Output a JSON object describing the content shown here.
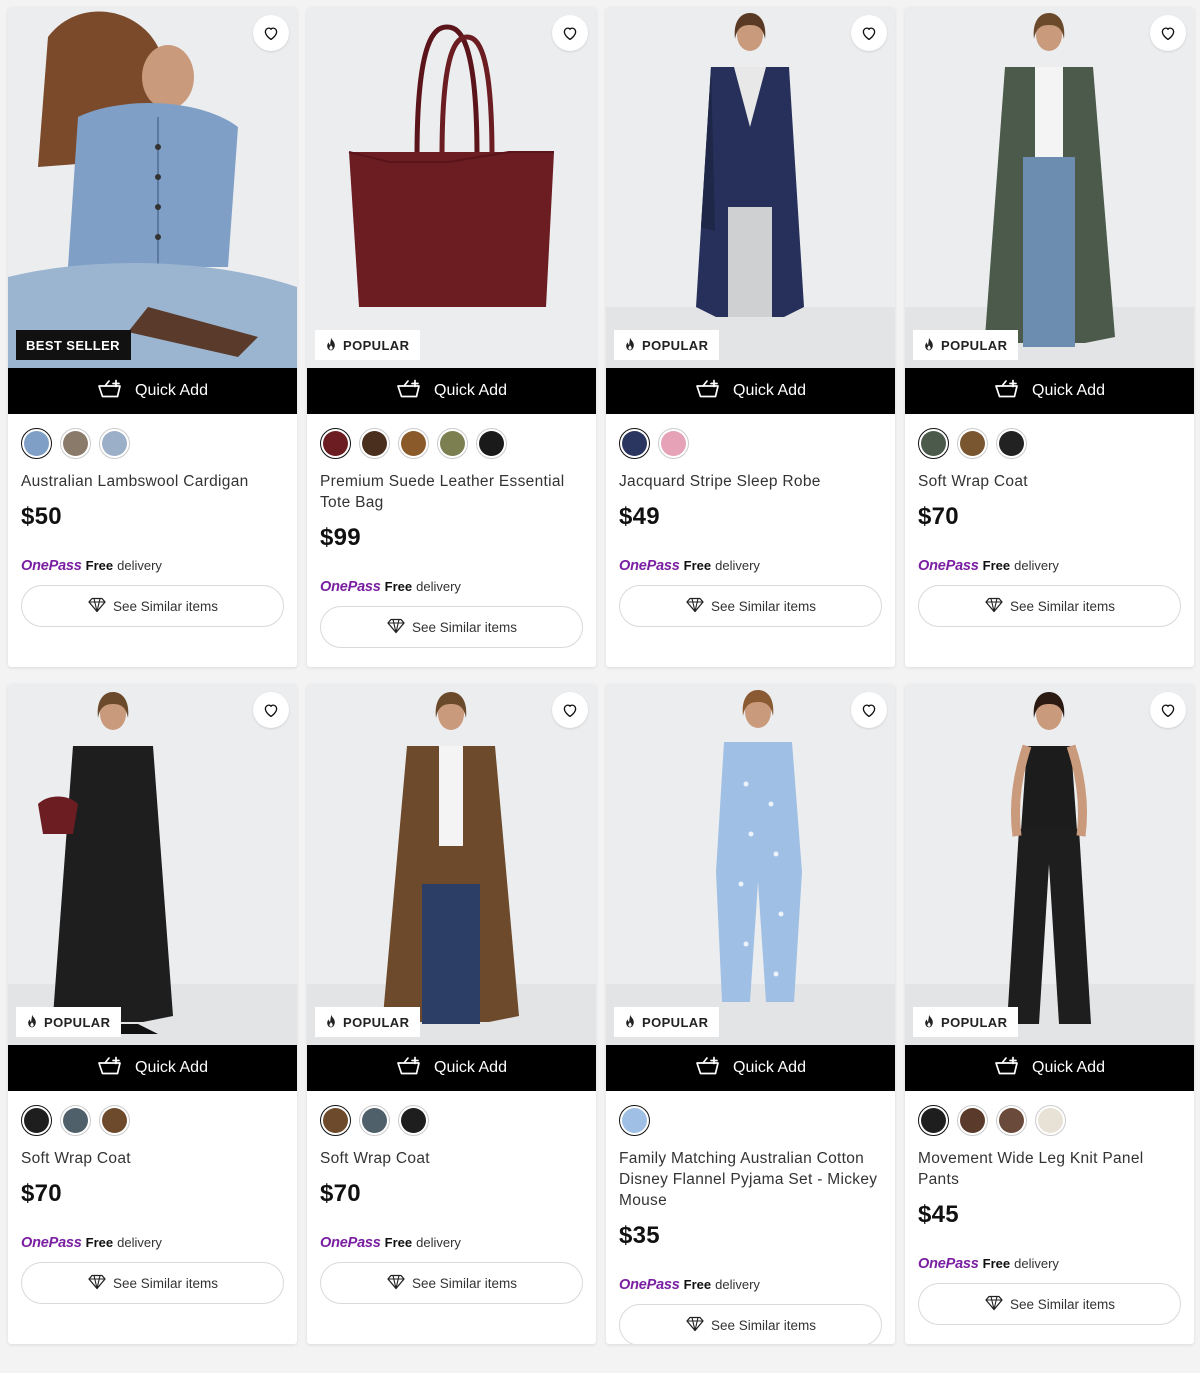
{
  "labels": {
    "quick_add": "Quick Add",
    "onepass": "OnePass",
    "free": "Free",
    "delivery": "delivery",
    "see_similar": "See Similar items"
  },
  "colors": {
    "onepass": "#7a1fa2",
    "badge_dark": "#111111",
    "quick_add_bg": "#000000"
  },
  "products": [
    {
      "title": "Australian Lambswool Cardigan",
      "price": "$50",
      "badge": "BEST SELLER",
      "badge_style": "best",
      "image": "cardigan",
      "swatches": [
        "#7f9fc6",
        "#8a7a6a",
        "#9bb0c8"
      ]
    },
    {
      "title": "Premium Suede Leather Essential Tote Bag",
      "price": "$99",
      "badge": "POPULAR",
      "badge_style": "pop",
      "image": "tote",
      "swatches": [
        "#6b1d22",
        "#4a2e1e",
        "#8b5a2b",
        "#7c8050",
        "#1a1a1a"
      ]
    },
    {
      "title": "Jacquard Stripe Sleep Robe",
      "price": "$49",
      "badge": "POPULAR",
      "badge_style": "pop",
      "image": "robe",
      "swatches": [
        "#2a3660",
        "#e6a3b8"
      ]
    },
    {
      "title": "Soft Wrap Coat",
      "price": "$70",
      "badge": "POPULAR",
      "badge_style": "pop",
      "image": "coat-green",
      "swatches": [
        "#4b5a4a",
        "#7a5630",
        "#222222"
      ]
    },
    {
      "title": "Soft Wrap Coat",
      "price": "$70",
      "badge": "POPULAR",
      "badge_style": "pop",
      "image": "coat-black",
      "swatches": [
        "#1e1e1e",
        "#50606a",
        "#6e4a2c"
      ]
    },
    {
      "title": "Soft Wrap Coat",
      "price": "$70",
      "badge": "POPULAR",
      "badge_style": "pop",
      "image": "coat-brown",
      "swatches": [
        "#6e4a2c",
        "#50606a",
        "#1e1e1e"
      ]
    },
    {
      "title": "Family Matching Australian Cotton Disney Flannel Pyjama Set - Mickey Mouse",
      "price": "$35",
      "badge": "POPULAR",
      "badge_style": "pop",
      "image": "pyjama",
      "swatches": [
        "#9fc0e4"
      ]
    },
    {
      "title": "Movement Wide Leg Knit Panel Pants",
      "price": "$45",
      "badge": "POPULAR",
      "badge_style": "pop",
      "image": "pants",
      "swatches": [
        "#1e1e1e",
        "#5a3a2a",
        "#6a4a3a",
        "#e8e2d6"
      ]
    }
  ]
}
